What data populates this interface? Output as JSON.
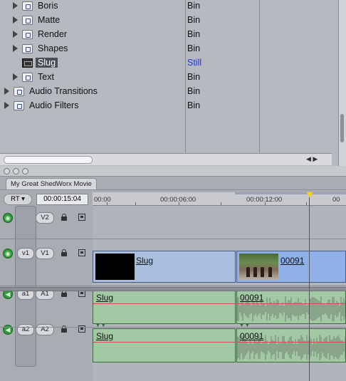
{
  "browser": {
    "items": [
      {
        "name": "Boris",
        "type": "Bin",
        "indent": 1,
        "kind": "bin"
      },
      {
        "name": "Matte",
        "type": "Bin",
        "indent": 1,
        "kind": "bin"
      },
      {
        "name": "Render",
        "type": "Bin",
        "indent": 1,
        "kind": "bin"
      },
      {
        "name": "Shapes",
        "type": "Bin",
        "indent": 1,
        "kind": "bin"
      },
      {
        "name": "Slug",
        "type": "Still",
        "indent": 1,
        "kind": "clip",
        "selected": true
      },
      {
        "name": "Text",
        "type": "Bin",
        "indent": 1,
        "kind": "bin"
      },
      {
        "name": "Audio Transitions",
        "type": "Bin",
        "indent": 0,
        "kind": "bin"
      },
      {
        "name": "Audio Filters",
        "type": "Bin",
        "indent": 0,
        "kind": "bin"
      }
    ]
  },
  "timeline": {
    "tab_label": "My Great ShedWorx Movie",
    "rt_label": "RT",
    "timecode": "00:00:15:04",
    "ruler_labels": [
      "00:00",
      "00:00:06:00",
      "00:00:12:00",
      "00"
    ],
    "tracks": {
      "v2": {
        "dest": "",
        "label": "V2"
      },
      "v1": {
        "dest": "v1",
        "label": "V1"
      },
      "a1": {
        "dest": "a1",
        "label": "A1"
      },
      "a2": {
        "dest": "a2",
        "label": "A2"
      }
    },
    "clips": {
      "v1_slug": "Slug",
      "v1_photo": "00091",
      "a1_slug": "Slug",
      "a1_clip": "00091",
      "a2_slug": "Slug",
      "a2_clip": "00091"
    }
  },
  "colors": {
    "video_clip": "#a9bfe0",
    "audio_clip": "#a2c9a3",
    "playhead": "#f5d300",
    "still_type": "#2032e0"
  }
}
